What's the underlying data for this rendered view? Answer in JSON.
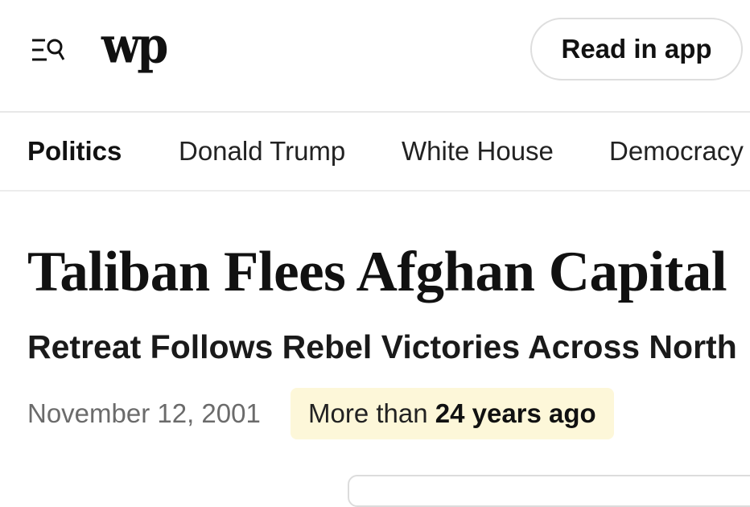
{
  "header": {
    "menu_icon": "menu-search-icon",
    "logo_text": "wp",
    "read_in_app_label": "Read in app"
  },
  "nav": {
    "items": [
      {
        "label": "Politics",
        "active": true
      },
      {
        "label": "Donald Trump",
        "active": false
      },
      {
        "label": "White House",
        "active": false
      },
      {
        "label": "Democracy",
        "active": false
      }
    ]
  },
  "article": {
    "headline": "Taliban Flees Afghan Capital",
    "subheadline": "Retreat Follows Rebel Victories Across North",
    "date": "November 12, 2001",
    "age_prefix": "More than ",
    "age_value": "24 years ago"
  },
  "colors": {
    "badge_background": "#fdf7d9",
    "date_text": "#6b6b6b"
  }
}
